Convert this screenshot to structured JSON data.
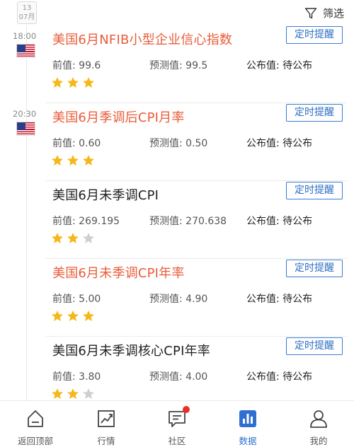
{
  "header": {
    "date_day": "13",
    "date_month": "07月",
    "filter_label": "筛选"
  },
  "times": [
    "18:00",
    "20:30"
  ],
  "labels": {
    "previous": "前值: ",
    "forecast": "预测值: ",
    "actual": "公布值: ",
    "remind": "定时提醒"
  },
  "colors": {
    "highlight": "#e85d3a",
    "accent": "#2f6fd2",
    "star_on": "#f5b81b",
    "star_off": "#cfcfcf"
  },
  "events": [
    {
      "title": "美国6月NFIB小型企业信心指数",
      "highlighted": true,
      "previous": "99.6",
      "forecast": "99.5",
      "actual": "待公布",
      "stars": 3
    },
    {
      "title": "美国6月季调后CPI月率",
      "highlighted": true,
      "previous": "0.60",
      "forecast": "0.50",
      "actual": "待公布",
      "stars": 3
    },
    {
      "title": "美国6月未季调CPI",
      "highlighted": false,
      "previous": "269.195",
      "forecast": "270.638",
      "actual": "待公布",
      "stars": 2
    },
    {
      "title": "美国6月未季调CPI年率",
      "highlighted": true,
      "previous": "5.00",
      "forecast": "4.90",
      "actual": "待公布",
      "stars": 3
    },
    {
      "title": "美国6月未季调核心CPI年率",
      "highlighted": false,
      "previous": "3.80",
      "forecast": "4.00",
      "actual": "待公布",
      "stars": 2
    }
  ],
  "tabs": [
    {
      "label": "返回顶部",
      "icon": "home-icon"
    },
    {
      "label": "行情",
      "icon": "chart-icon"
    },
    {
      "label": "社区",
      "icon": "chat-icon"
    },
    {
      "label": "数据",
      "icon": "bar-chart-icon",
      "active": true
    },
    {
      "label": "我的",
      "icon": "user-icon"
    }
  ]
}
